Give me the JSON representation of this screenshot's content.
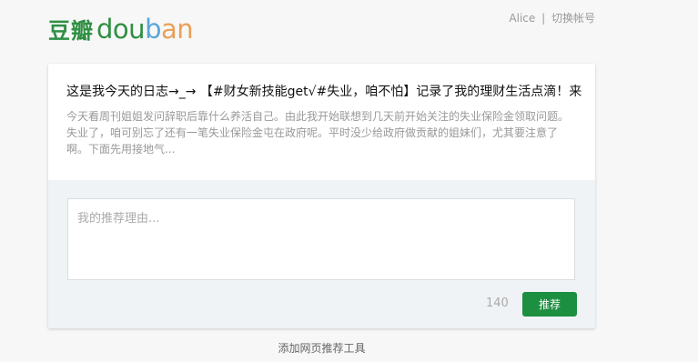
{
  "logo": {
    "cn": "豆瓣",
    "en": [
      "d",
      "o",
      "u",
      "b",
      "a",
      "n"
    ]
  },
  "account": {
    "user": "Alice",
    "separator": "|",
    "switch_label": "切换帐号"
  },
  "post": {
    "title": "这是我今天的日志→_→ 【#财女新技能get√#失业，咱不怕】记录了我的理财生活点滴！来",
    "summary": "今天看周刊姐姐发问辞职后靠什么养活自己。由此我开始联想到几天前开始关注的失业保险金领取问题。失业了，咱可别忘了还有一笔失业保险金屯在政府呢。平时没少给政府做贡献的姐妹们，尤其要注意了啊。下面先用接地气..."
  },
  "recommend": {
    "placeholder": "我的推荐理由...",
    "value": "",
    "char_count": "140",
    "submit_label": "推荐"
  },
  "footer": {
    "tool_link": "添加网页推荐工具"
  },
  "colors": {
    "brand_green": "#2f8f43",
    "button_green": "#1d8f40",
    "card_bg": "#ffffff",
    "area_bg": "#f0f3f5"
  }
}
